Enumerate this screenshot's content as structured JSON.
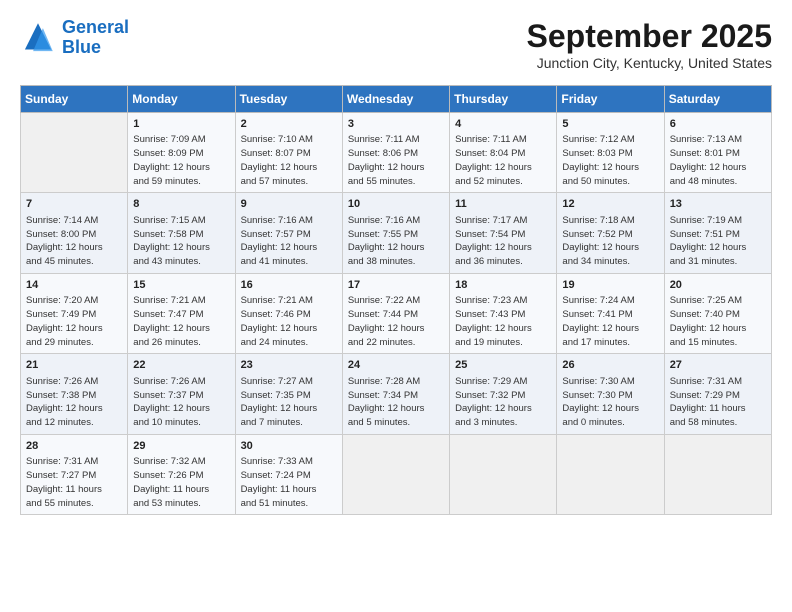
{
  "logo": {
    "line1": "General",
    "line2": "Blue"
  },
  "title": "September 2025",
  "subtitle": "Junction City, Kentucky, United States",
  "weekdays": [
    "Sunday",
    "Monday",
    "Tuesday",
    "Wednesday",
    "Thursday",
    "Friday",
    "Saturday"
  ],
  "weeks": [
    [
      {
        "num": "",
        "info": ""
      },
      {
        "num": "1",
        "info": "Sunrise: 7:09 AM\nSunset: 8:09 PM\nDaylight: 12 hours\nand 59 minutes."
      },
      {
        "num": "2",
        "info": "Sunrise: 7:10 AM\nSunset: 8:07 PM\nDaylight: 12 hours\nand 57 minutes."
      },
      {
        "num": "3",
        "info": "Sunrise: 7:11 AM\nSunset: 8:06 PM\nDaylight: 12 hours\nand 55 minutes."
      },
      {
        "num": "4",
        "info": "Sunrise: 7:11 AM\nSunset: 8:04 PM\nDaylight: 12 hours\nand 52 minutes."
      },
      {
        "num": "5",
        "info": "Sunrise: 7:12 AM\nSunset: 8:03 PM\nDaylight: 12 hours\nand 50 minutes."
      },
      {
        "num": "6",
        "info": "Sunrise: 7:13 AM\nSunset: 8:01 PM\nDaylight: 12 hours\nand 48 minutes."
      }
    ],
    [
      {
        "num": "7",
        "info": "Sunrise: 7:14 AM\nSunset: 8:00 PM\nDaylight: 12 hours\nand 45 minutes."
      },
      {
        "num": "8",
        "info": "Sunrise: 7:15 AM\nSunset: 7:58 PM\nDaylight: 12 hours\nand 43 minutes."
      },
      {
        "num": "9",
        "info": "Sunrise: 7:16 AM\nSunset: 7:57 PM\nDaylight: 12 hours\nand 41 minutes."
      },
      {
        "num": "10",
        "info": "Sunrise: 7:16 AM\nSunset: 7:55 PM\nDaylight: 12 hours\nand 38 minutes."
      },
      {
        "num": "11",
        "info": "Sunrise: 7:17 AM\nSunset: 7:54 PM\nDaylight: 12 hours\nand 36 minutes."
      },
      {
        "num": "12",
        "info": "Sunrise: 7:18 AM\nSunset: 7:52 PM\nDaylight: 12 hours\nand 34 minutes."
      },
      {
        "num": "13",
        "info": "Sunrise: 7:19 AM\nSunset: 7:51 PM\nDaylight: 12 hours\nand 31 minutes."
      }
    ],
    [
      {
        "num": "14",
        "info": "Sunrise: 7:20 AM\nSunset: 7:49 PM\nDaylight: 12 hours\nand 29 minutes."
      },
      {
        "num": "15",
        "info": "Sunrise: 7:21 AM\nSunset: 7:47 PM\nDaylight: 12 hours\nand 26 minutes."
      },
      {
        "num": "16",
        "info": "Sunrise: 7:21 AM\nSunset: 7:46 PM\nDaylight: 12 hours\nand 24 minutes."
      },
      {
        "num": "17",
        "info": "Sunrise: 7:22 AM\nSunset: 7:44 PM\nDaylight: 12 hours\nand 22 minutes."
      },
      {
        "num": "18",
        "info": "Sunrise: 7:23 AM\nSunset: 7:43 PM\nDaylight: 12 hours\nand 19 minutes."
      },
      {
        "num": "19",
        "info": "Sunrise: 7:24 AM\nSunset: 7:41 PM\nDaylight: 12 hours\nand 17 minutes."
      },
      {
        "num": "20",
        "info": "Sunrise: 7:25 AM\nSunset: 7:40 PM\nDaylight: 12 hours\nand 15 minutes."
      }
    ],
    [
      {
        "num": "21",
        "info": "Sunrise: 7:26 AM\nSunset: 7:38 PM\nDaylight: 12 hours\nand 12 minutes."
      },
      {
        "num": "22",
        "info": "Sunrise: 7:26 AM\nSunset: 7:37 PM\nDaylight: 12 hours\nand 10 minutes."
      },
      {
        "num": "23",
        "info": "Sunrise: 7:27 AM\nSunset: 7:35 PM\nDaylight: 12 hours\nand 7 minutes."
      },
      {
        "num": "24",
        "info": "Sunrise: 7:28 AM\nSunset: 7:34 PM\nDaylight: 12 hours\nand 5 minutes."
      },
      {
        "num": "25",
        "info": "Sunrise: 7:29 AM\nSunset: 7:32 PM\nDaylight: 12 hours\nand 3 minutes."
      },
      {
        "num": "26",
        "info": "Sunrise: 7:30 AM\nSunset: 7:30 PM\nDaylight: 12 hours\nand 0 minutes."
      },
      {
        "num": "27",
        "info": "Sunrise: 7:31 AM\nSunset: 7:29 PM\nDaylight: 11 hours\nand 58 minutes."
      }
    ],
    [
      {
        "num": "28",
        "info": "Sunrise: 7:31 AM\nSunset: 7:27 PM\nDaylight: 11 hours\nand 55 minutes."
      },
      {
        "num": "29",
        "info": "Sunrise: 7:32 AM\nSunset: 7:26 PM\nDaylight: 11 hours\nand 53 minutes."
      },
      {
        "num": "30",
        "info": "Sunrise: 7:33 AM\nSunset: 7:24 PM\nDaylight: 11 hours\nand 51 minutes."
      },
      {
        "num": "",
        "info": ""
      },
      {
        "num": "",
        "info": ""
      },
      {
        "num": "",
        "info": ""
      },
      {
        "num": "",
        "info": ""
      }
    ]
  ]
}
